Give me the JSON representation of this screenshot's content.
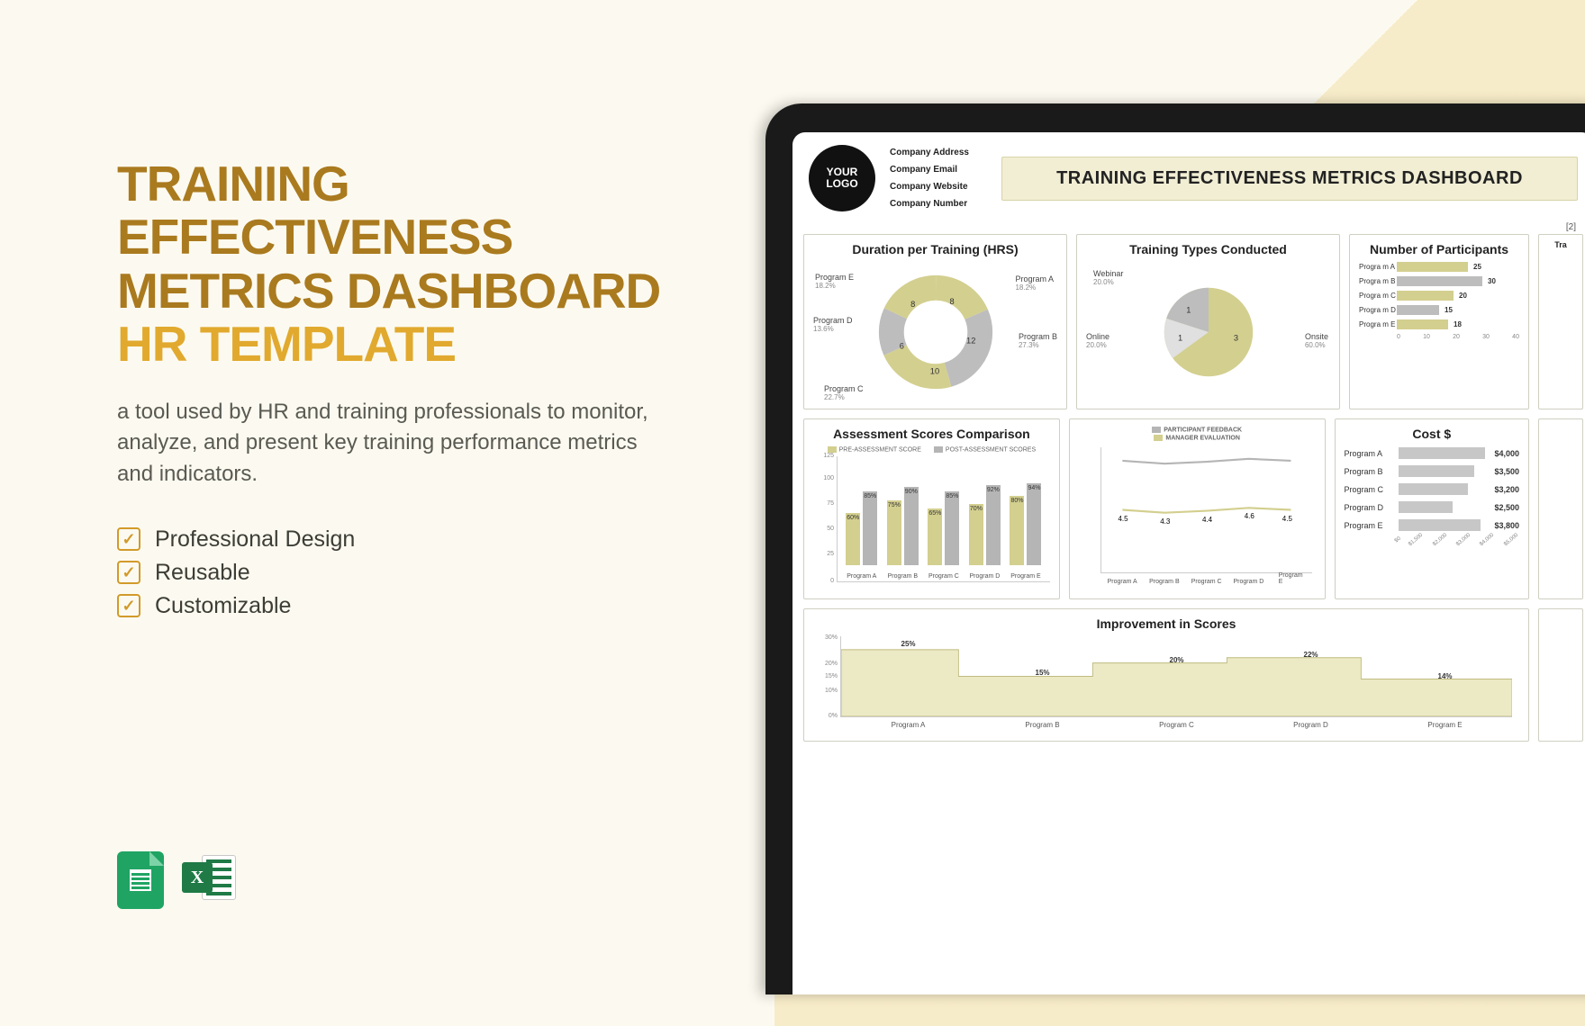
{
  "left": {
    "title_l1": "TRAINING",
    "title_l2": "EFFECTIVENESS",
    "title_l3": "METRICS DASHBOARD",
    "title_l4": "HR TEMPLATE",
    "desc": "a tool used by HR and training professionals to monitor, analyze, and present key training performance metrics and indicators.",
    "checks": [
      "Professional Design",
      "Reusable",
      "Customizable"
    ]
  },
  "header": {
    "logo_l1": "YOUR",
    "logo_l2": "LOGO",
    "lines": [
      "Company Address",
      "Company Email",
      "Company Website",
      "Company Number"
    ],
    "title": "TRAINING EFFECTIVENESS METRICS DASHBOARD",
    "badge": "[2]"
  },
  "cards": {
    "duration_title": "Duration per Training (HRS)",
    "types_title": "Training Types Conducted",
    "participants_title": "Number of Participants",
    "assessment_title": "Assessment Scores Comparison",
    "assessment_legend": [
      "PRE-ASSESSMENT SCORE",
      "POST-ASSESSMENT SCORES"
    ],
    "feedback_l1": "PARTICIPANT FEEDBACK",
    "feedback_l2": "MANAGER EVALUATION",
    "cost_title": "Cost $",
    "improvement_title": "Improvement in Scores",
    "trimmed": "Tra"
  },
  "chart_data": [
    {
      "type": "pie",
      "name": "duration",
      "title": "Duration per Training (HRS)",
      "categories": [
        "Program A",
        "Program B",
        "Program C",
        "Program D",
        "Program E"
      ],
      "values": [
        8,
        12,
        10,
        6,
        8
      ],
      "percent_labels": [
        "18.2%",
        "27.3%",
        "22.7%",
        "13.6%",
        "18.2%"
      ],
      "donut": true
    },
    {
      "type": "pie",
      "name": "types",
      "title": "Training Types Conducted",
      "categories": [
        "Onsite",
        "Online",
        "Webinar"
      ],
      "values": [
        3,
        1,
        1
      ],
      "percent_labels": [
        "60.0%",
        "20.0%",
        "20.0%"
      ]
    },
    {
      "type": "bar",
      "name": "participants",
      "orientation": "h",
      "title": "Number of Participants",
      "categories": [
        "Progra m A",
        "Progra m B",
        "Progra m C",
        "Progra m D",
        "Progra m E"
      ],
      "values": [
        25,
        30,
        20,
        15,
        18
      ],
      "xticks": [
        0,
        10,
        20,
        30,
        40
      ]
    },
    {
      "type": "bar",
      "name": "assessment",
      "title": "Assessment Scores Comparison",
      "categories": [
        "Program A",
        "Program B",
        "Program C",
        "Program D",
        "Program E"
      ],
      "series": [
        {
          "name": "PRE-ASSESSMENT SCORE",
          "values": [
            60,
            75,
            65,
            70,
            80
          ]
        },
        {
          "name": "POST-ASSESSMENT SCORES",
          "values": [
            85,
            90,
            85,
            92,
            94
          ]
        }
      ],
      "ylim": [
        0,
        125
      ],
      "yticks": [
        0,
        25,
        50,
        75,
        100,
        125
      ]
    },
    {
      "type": "line",
      "name": "feedback",
      "title": "Participant Feedback / Manager Evaluation",
      "categories": [
        "Program A",
        "Program B",
        "Program C",
        "Program D",
        "Program E"
      ],
      "series": [
        {
          "name": "PARTICIPANT FEEDBACK",
          "values": [
            8.1,
            7.9,
            8.0,
            8.2,
            8.1
          ]
        },
        {
          "name": "MANAGER EVALUATION",
          "values": [
            4.5,
            4.3,
            4.4,
            4.6,
            4.5
          ]
        }
      ],
      "ylim": [
        0,
        9
      ]
    },
    {
      "type": "bar",
      "name": "cost",
      "orientation": "h",
      "title": "Cost $",
      "categories": [
        "Program A",
        "Program B",
        "Program C",
        "Program D",
        "Program E"
      ],
      "values": [
        4000,
        3500,
        3200,
        2500,
        3800
      ],
      "value_labels": [
        "$4,000",
        "$3,500",
        "$3,200",
        "$2,500",
        "$3,800"
      ],
      "xticks": [
        "$0",
        "$1,500",
        "$2,000",
        "$3,000",
        "$4,000",
        "$5,000"
      ]
    },
    {
      "type": "area",
      "name": "improvement",
      "title": "Improvement in Scores",
      "categories": [
        "Program A",
        "Program B",
        "Program C",
        "Program D",
        "Program E"
      ],
      "values": [
        25,
        15,
        20,
        22,
        14
      ],
      "value_labels": [
        "25%",
        "15%",
        "20%",
        "22%",
        "14%"
      ],
      "ylim": [
        0,
        30
      ],
      "yticks": [
        "0%",
        "10%",
        "15%",
        "20%",
        "30%"
      ]
    }
  ]
}
